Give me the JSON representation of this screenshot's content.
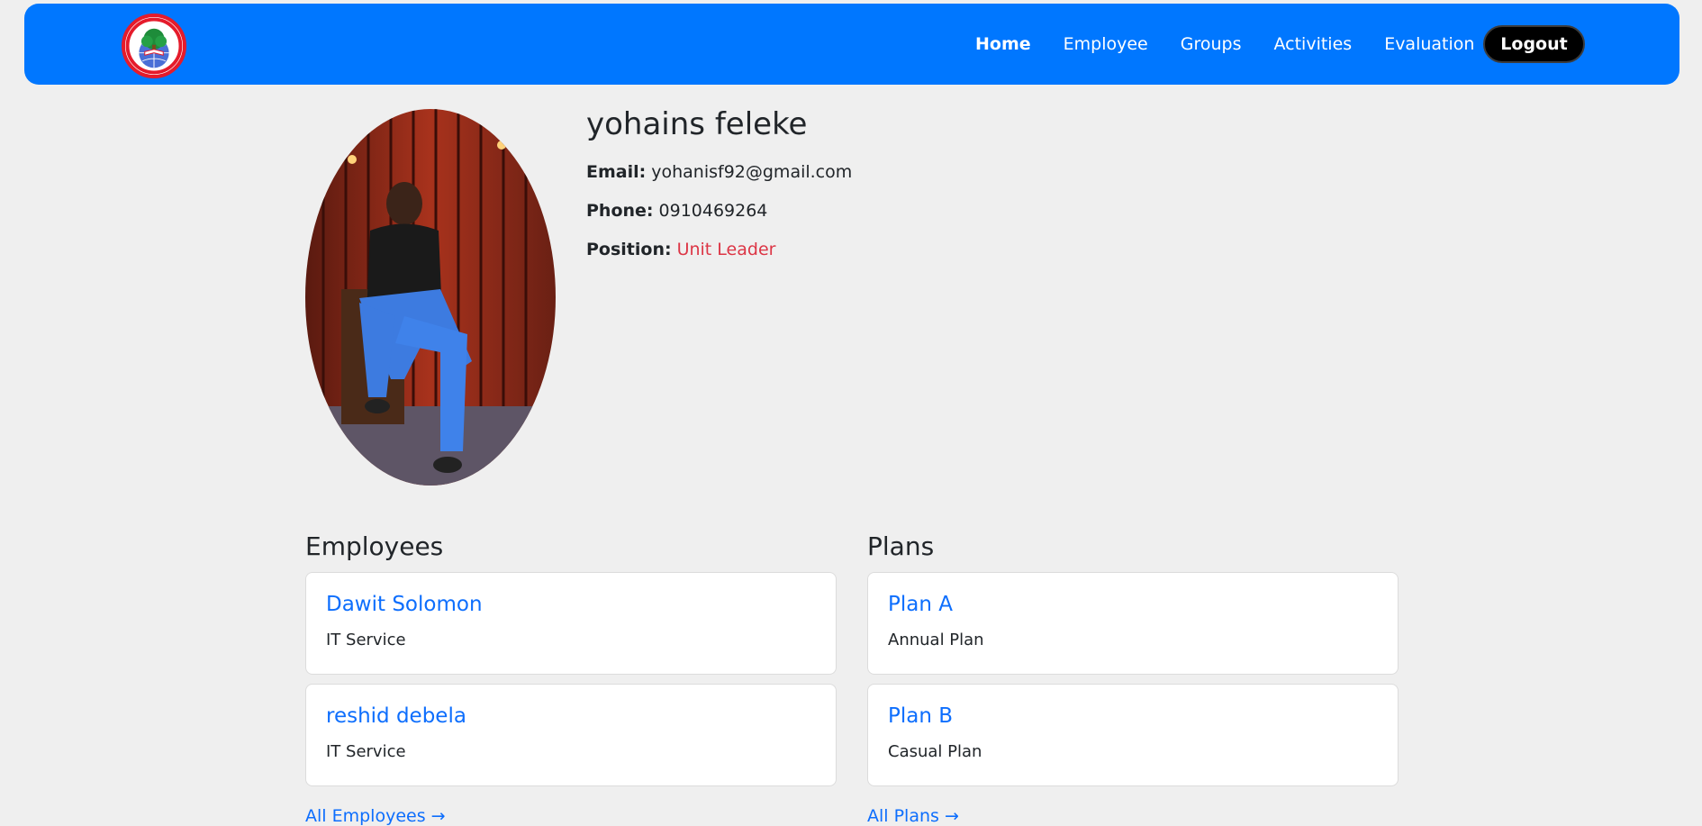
{
  "nav": {
    "links": [
      {
        "label": "Home",
        "active": true
      },
      {
        "label": "Employee",
        "active": false
      },
      {
        "label": "Groups",
        "active": false
      },
      {
        "label": "Activities",
        "active": false
      },
      {
        "label": "Evaluation",
        "active": false
      }
    ],
    "logout_label": "Logout",
    "color": "#0077ff"
  },
  "profile": {
    "name": "yohains feleke",
    "email_label": "Email:",
    "email": "yohanisf92@gmail.com",
    "phone_label": "Phone:",
    "phone": "0910469264",
    "position_label": "Position:",
    "position": "Unit Leader"
  },
  "employees": {
    "title": "Employees",
    "items": [
      {
        "name": "Dawit Solomon",
        "department": "IT Service"
      },
      {
        "name": "reshid debela",
        "department": "IT Service"
      }
    ],
    "all_link": "All Employees →"
  },
  "plans": {
    "title": "Plans",
    "items": [
      {
        "name": "Plan A",
        "type": "Annual Plan"
      },
      {
        "name": "Plan B",
        "type": "Casual Plan"
      }
    ],
    "all_link": "All Plans →"
  },
  "colors": {
    "link": "#0d6efd",
    "position": "#dc3545",
    "background": "#efefef"
  },
  "icons": {
    "logo": "organization-logo",
    "profile": "profile-photo"
  }
}
